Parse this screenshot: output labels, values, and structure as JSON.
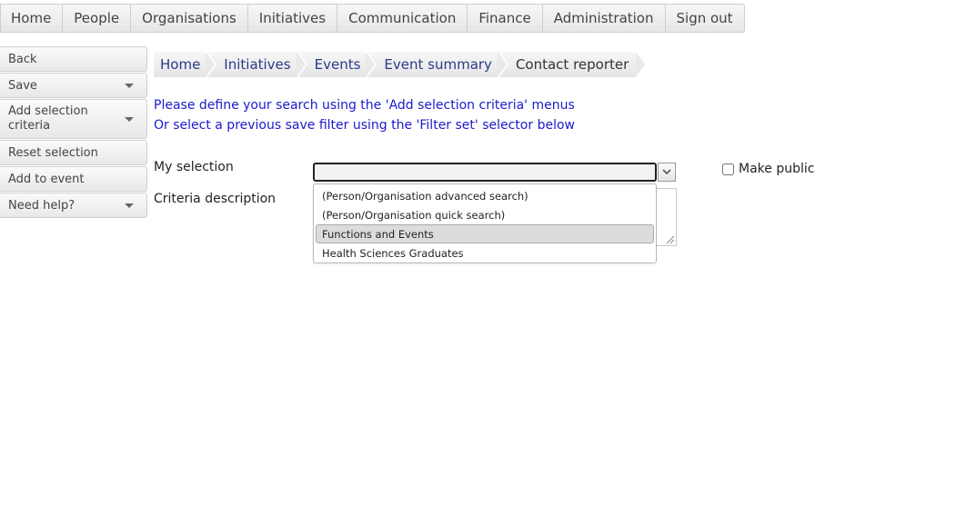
{
  "topnav": {
    "items": [
      "Home",
      "People",
      "Organisations",
      "Initiatives",
      "Communication",
      "Finance",
      "Administration",
      "Sign out"
    ]
  },
  "sidemenu": {
    "back": "Back",
    "save": "Save",
    "add_selection_criteria": "Add selection criteria",
    "reset_selection": "Reset selection",
    "add_to_event": "Add to event",
    "need_help": "Need help?"
  },
  "breadcrumb": {
    "items": [
      "Home",
      "Initiatives",
      "Events",
      "Event summary",
      "Contact reporter"
    ]
  },
  "instructions": {
    "line1": "Please define your search using the 'Add selection criteria' menus",
    "line2": "Or select a previous save filter using the 'Filter set' selector below"
  },
  "form": {
    "my_selection_label": "My selection",
    "my_selection_value": "",
    "criteria_description_label": "Criteria description",
    "make_public_label": "Make public",
    "make_public_checked": false,
    "dropdown_options": [
      "(Person/Organisation advanced search)",
      "(Person/Organisation quick search)",
      "Functions and Events",
      "Health Sciences Graduates"
    ],
    "highlighted_option": "Functions and Events"
  }
}
